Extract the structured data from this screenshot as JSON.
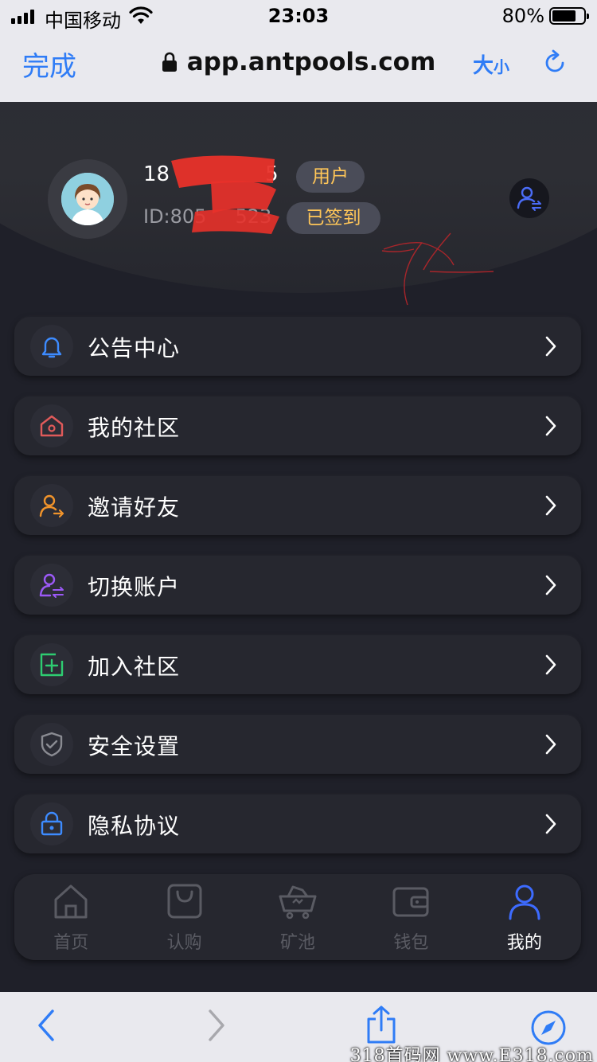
{
  "status_bar": {
    "carrier": "中国移动",
    "time": "23:03",
    "battery_percent": "80%",
    "battery_level": 0.8
  },
  "browser": {
    "done_label": "完成",
    "url": "app.antpools.com",
    "text_size_big": "大",
    "text_size_small": "小",
    "accent": "#2f7cf6"
  },
  "profile": {
    "phone_prefix": "18",
    "phone_suffix": "5",
    "id_text": "ID:805",
    "id_tail": "523",
    "role_badge": "用户",
    "signin_badge": "已签到",
    "badge_text_color": "#ffc658"
  },
  "menu": {
    "items": [
      {
        "label": "公告中心",
        "icon": "bell-icon",
        "color": "#3d8bff"
      },
      {
        "label": "我的社区",
        "icon": "home-icon",
        "color": "#e05a5a"
      },
      {
        "label": "邀请好友",
        "icon": "invite-user-icon",
        "color": "#f0932b"
      },
      {
        "label": "切换账户",
        "icon": "switch-account-icon",
        "color": "#9b59f6"
      },
      {
        "label": "加入社区",
        "icon": "add-square-icon",
        "color": "#2ecc71"
      },
      {
        "label": "安全设置",
        "icon": "shield-icon",
        "color": "#8a8b92"
      },
      {
        "label": "隐私协议",
        "icon": "lock-icon",
        "color": "#3d8bff"
      }
    ]
  },
  "tabbar": {
    "items": [
      {
        "label": "首页",
        "icon": "home-icon",
        "active": false
      },
      {
        "label": "认购",
        "icon": "bag-icon",
        "active": false
      },
      {
        "label": "矿池",
        "icon": "mining-cart-icon",
        "active": false
      },
      {
        "label": "钱包",
        "icon": "wallet-icon",
        "active": false
      },
      {
        "label": "我的",
        "icon": "profile-icon",
        "active": true
      }
    ],
    "active_color": "#3d6bff"
  },
  "watermark": "318首码网 www.E318.com"
}
